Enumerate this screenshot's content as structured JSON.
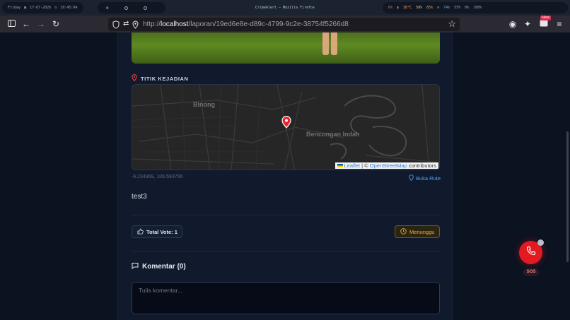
{
  "os": {
    "day": "Friday",
    "date": "17-07-2026",
    "time": "19:45:04",
    "window_title": "CrimeAlert — Mozilla Firefox",
    "stats": {
      "s1": "6%",
      "temp": "38°C",
      "s3": "58%",
      "s4": "65%",
      "s5": "74%",
      "s6": "55%",
      "s7": "0%",
      "battery": "100%"
    }
  },
  "browser": {
    "url_prefix": "http://",
    "url_host": "localhost",
    "url_path": "/laporan/19ed6e8e-d89c-4799-9c2e-38754f5266d8",
    "new_badge": "New"
  },
  "report": {
    "location_label": "TITIK KEJADIAN",
    "map": {
      "places": [
        "Binong",
        "Bencongan Indah"
      ],
      "attribution_leaflet": "Leaflet",
      "attribution_osm": "OpenStreetMap",
      "attribution_suffix": "contributors"
    },
    "coordinates": "-6.234969, 106.593766",
    "route_label": "Buka Rute",
    "description": "test3",
    "vote_label": "Total Vote: 1",
    "status_label": "Menunggu",
    "comments_title": "Komentar (0)",
    "comment_placeholder": "Tulis komentar..."
  },
  "sos": {
    "label": "SOS"
  },
  "colors": {
    "accent": "#4ea3ff",
    "sos": "#e21a22",
    "status": "#e8b03a",
    "background": "#0b1220"
  }
}
